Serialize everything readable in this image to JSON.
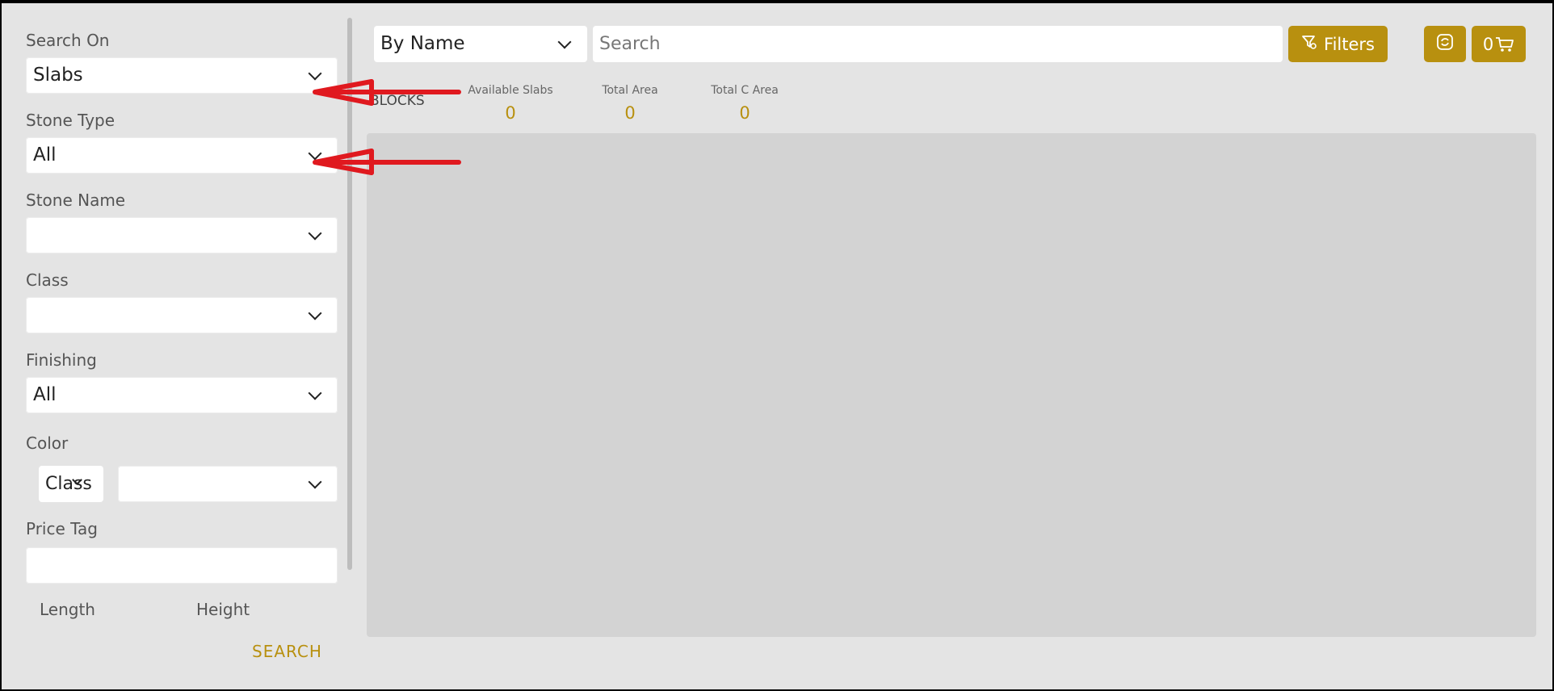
{
  "sidebar": {
    "search_on": {
      "label": "Search On",
      "value": "Slabs"
    },
    "stone_type": {
      "label": "Stone Type",
      "value": "All"
    },
    "stone_name": {
      "label": "Stone Name",
      "value": ""
    },
    "class": {
      "label": "Class",
      "value": ""
    },
    "finishing": {
      "label": "Finishing",
      "value": "All"
    },
    "color": {
      "label": "Color",
      "mode_value": "Class",
      "value": ""
    },
    "price_tag": {
      "label": "Price Tag",
      "value": ""
    },
    "length_label": "Length",
    "height_label": "Height",
    "search_button": "SEARCH"
  },
  "toolbar": {
    "search_by": "By Name",
    "search_placeholder": "Search",
    "filters_label": "Filters",
    "cart_count": "0"
  },
  "stats": {
    "blocks_label": "BLOCKS",
    "available_slabs": {
      "label": "Available Slabs",
      "value": "0"
    },
    "total_area": {
      "label": "Total Area",
      "value": "0"
    },
    "total_c_area": {
      "label": "Total C Area",
      "value": "0"
    }
  },
  "colors": {
    "accent": "#b8900f",
    "annotation": "#e0191f",
    "background": "#e4e4e4",
    "content_area": "#d3d3d3"
  },
  "icons": [
    "chevron-down-icon",
    "filter-icon",
    "sync-icon",
    "cart-icon"
  ]
}
